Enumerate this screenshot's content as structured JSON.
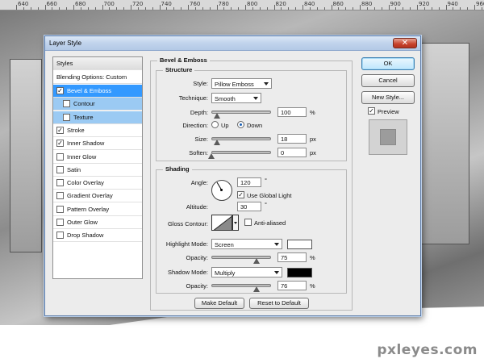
{
  "ruler": {
    "ticks": [
      "640",
      "660",
      "680",
      "700",
      "720",
      "740",
      "760",
      "780",
      "800",
      "820",
      "840",
      "860",
      "880",
      "900",
      "920",
      "940",
      "960"
    ]
  },
  "watermark": "pxleyes.com",
  "dialog": {
    "title": "Layer Style",
    "close_glyph": "✕",
    "styles_panel": {
      "header": "Styles",
      "blending": "Blending Options: Custom",
      "items": [
        {
          "label": "Bevel & Emboss",
          "checked": true
        },
        {
          "label": "Contour",
          "checked": false
        },
        {
          "label": "Texture",
          "checked": false
        },
        {
          "label": "Stroke",
          "checked": true
        },
        {
          "label": "Inner Shadow",
          "checked": true
        },
        {
          "label": "Inner Glow",
          "checked": false
        },
        {
          "label": "Satin",
          "checked": false
        },
        {
          "label": "Color Overlay",
          "checked": false
        },
        {
          "label": "Gradient Overlay",
          "checked": false
        },
        {
          "label": "Pattern Overlay",
          "checked": false
        },
        {
          "label": "Outer Glow",
          "checked": false
        },
        {
          "label": "Drop Shadow",
          "checked": false
        }
      ],
      "check_glyph": "✓"
    },
    "bevel": {
      "title": "Bevel & Emboss",
      "structure": {
        "title": "Structure",
        "style_label": "Style:",
        "style_value": "Pillow Emboss",
        "technique_label": "Technique:",
        "technique_value": "Smooth",
        "depth_label": "Depth:",
        "depth_value": "100",
        "depth_unit": "%",
        "depth_level": 0.1,
        "direction_label": "Direction:",
        "direction_up": "Up",
        "direction_down": "Down",
        "direction_selected": "Down",
        "size_label": "Size:",
        "size_value": "18",
        "size_unit": "px",
        "size_level": 0.1,
        "soften_label": "Soften:",
        "soften_value": "0",
        "soften_unit": "px",
        "soften_level": 0.0
      },
      "shading": {
        "title": "Shading",
        "angle_label": "Angle:",
        "angle_value": "120",
        "angle_unit": "°",
        "use_global_light": "Use Global Light",
        "use_global_light_checked": true,
        "altitude_label": "Altitude:",
        "altitude_value": "30",
        "altitude_unit": "°",
        "gloss_contour_label": "Gloss Contour:",
        "anti_aliased": "Anti-aliased",
        "anti_aliased_checked": false,
        "highlight_mode_label": "Highlight Mode:",
        "highlight_mode_value": "Screen",
        "highlight_color": "#ffffff",
        "highlight_opacity_label": "Opacity:",
        "highlight_opacity_value": "75",
        "highlight_opacity_unit": "%",
        "highlight_opacity_level": 0.75,
        "shadow_mode_label": "Shadow Mode:",
        "shadow_mode_value": "Multiply",
        "shadow_color": "#000000",
        "shadow_opacity_label": "Opacity:",
        "shadow_opacity_value": "76",
        "shadow_opacity_unit": "%",
        "shadow_opacity_level": 0.76
      },
      "make_default": "Make Default",
      "reset_default": "Reset to Default"
    },
    "buttons": {
      "ok": "OK",
      "cancel": "Cancel",
      "new_style": "New Style..."
    },
    "preview": {
      "label": "Preview",
      "checked": true
    }
  },
  "colors": {
    "accent": "#3399ff",
    "sub_selected": "#9bcaf3"
  }
}
